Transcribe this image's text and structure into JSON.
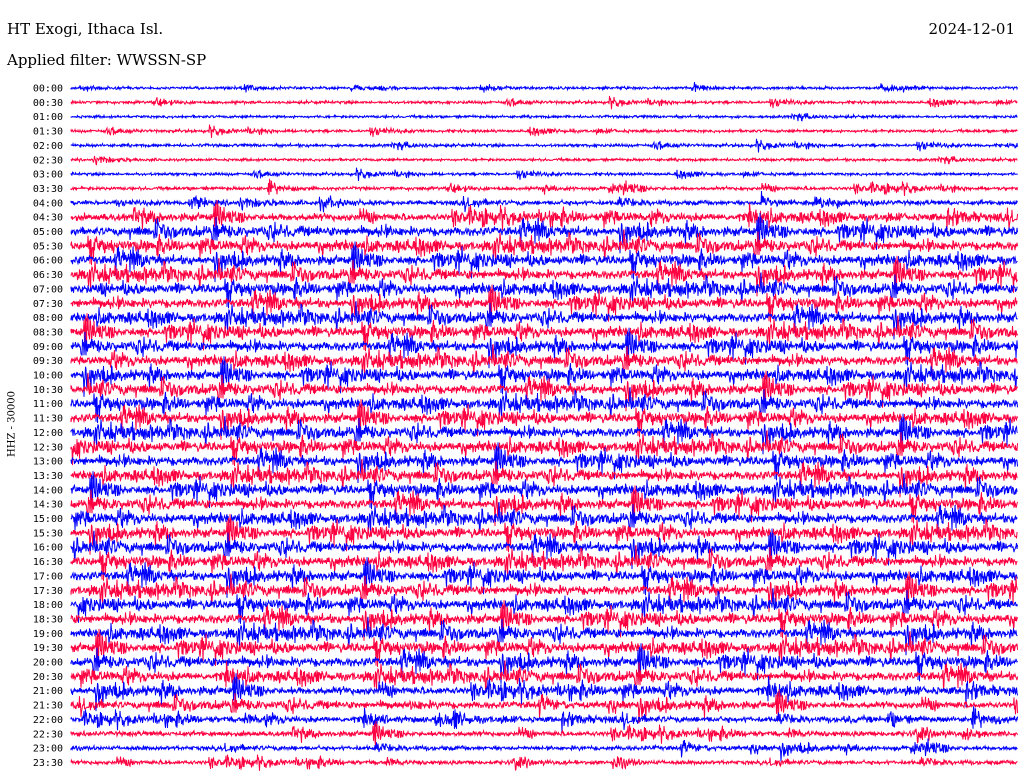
{
  "header": {
    "station": "HT Exogi, Ithaca Isl.",
    "date": "2024-12-01",
    "filter": "Applied filter: WWSSN-SP"
  },
  "chart_data": {
    "type": "line",
    "ylabel": "HHZ - 30000",
    "xlabel": "",
    "tick_labels": [
      "00:00",
      "00:30",
      "01:00",
      "01:30",
      "02:00",
      "02:30",
      "03:00",
      "03:30",
      "04:00",
      "04:30",
      "05:00",
      "05:30",
      "06:00",
      "06:30",
      "07:00",
      "07:30",
      "08:00",
      "08:30",
      "09:00",
      "09:30",
      "10:00",
      "10:30",
      "11:00",
      "11:30",
      "12:00",
      "12:30",
      "13:00",
      "13:30",
      "14:00",
      "14:30",
      "15:00",
      "15:30",
      "16:00",
      "16:30",
      "17:00",
      "17:30",
      "18:00",
      "18:30",
      "19:00",
      "19:30",
      "20:00",
      "20:30",
      "21:00",
      "21:30",
      "22:00",
      "22:30",
      "23:00",
      "23:30"
    ],
    "trace_colors": [
      "#0000ff",
      "#ff0040"
    ],
    "noise_level": [
      0.15,
      0.18,
      0.15,
      0.18,
      0.2,
      0.15,
      0.18,
      0.25,
      0.45,
      0.85,
      1.0,
      1.0,
      1.0,
      1.0,
      1.0,
      1.0,
      1.0,
      1.0,
      1.0,
      1.0,
      1.0,
      1.0,
      1.0,
      1.0,
      1.0,
      1.0,
      1.0,
      1.0,
      1.0,
      1.0,
      1.0,
      1.0,
      1.0,
      1.0,
      1.0,
      1.0,
      1.0,
      1.0,
      1.0,
      1.0,
      1.0,
      0.95,
      0.9,
      0.75,
      0.6,
      0.5,
      0.4,
      0.35
    ],
    "grid": false
  }
}
